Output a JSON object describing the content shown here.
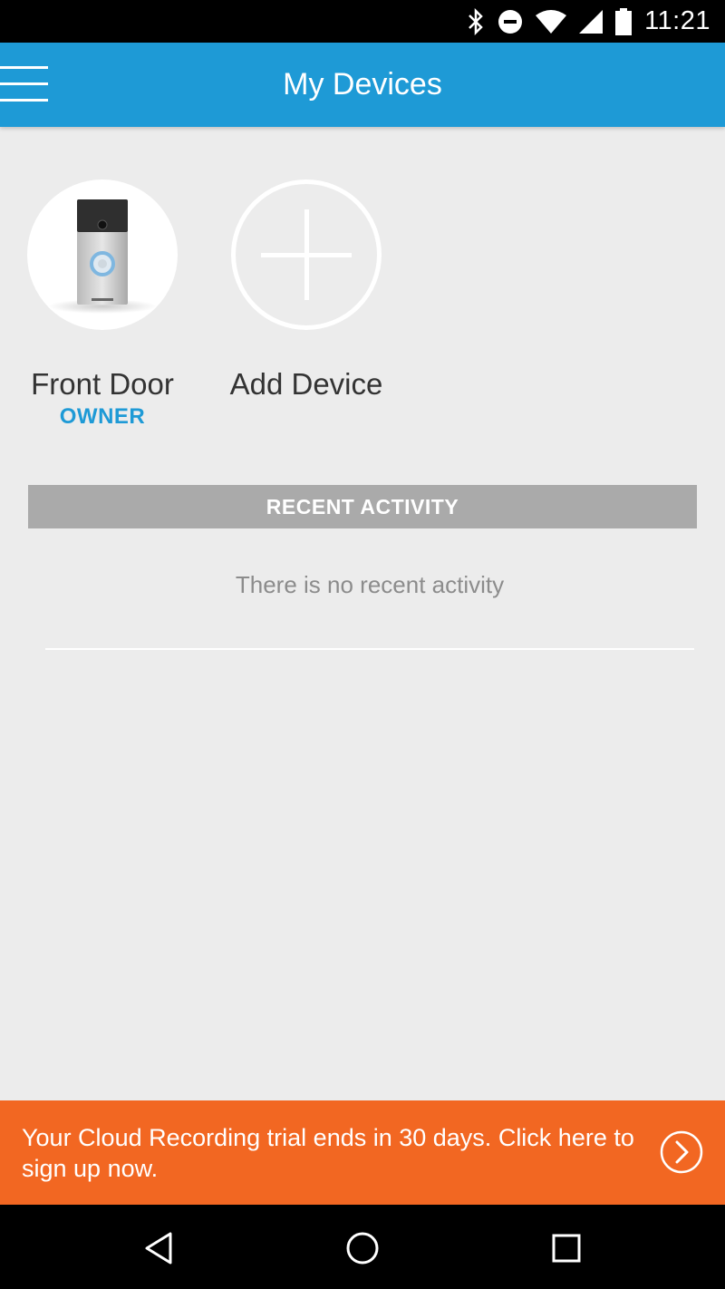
{
  "status_bar": {
    "time": "11:21",
    "icons": [
      "bluetooth-icon",
      "do-not-disturb-icon",
      "wifi-icon",
      "cell-signal-icon",
      "battery-icon"
    ]
  },
  "app_bar": {
    "title": "My Devices",
    "menu_icon": "hamburger-menu-icon",
    "color": "#1e9ad6"
  },
  "devices": [
    {
      "name": "Front Door",
      "role": "OWNER",
      "icon": "doorbell-image"
    },
    {
      "name": "Add Device",
      "icon": "plus-icon"
    }
  ],
  "recent_activity": {
    "header": "RECENT ACTIVITY",
    "empty_message": "There is no recent activity"
  },
  "promo": {
    "text": "Your Cloud Recording trial ends in 30 days. Click here to sign up now.",
    "icon": "chevron-right-circle-icon",
    "color": "#f26722"
  },
  "nav_bar": {
    "icons": [
      "back-icon",
      "home-icon",
      "recents-icon"
    ]
  }
}
